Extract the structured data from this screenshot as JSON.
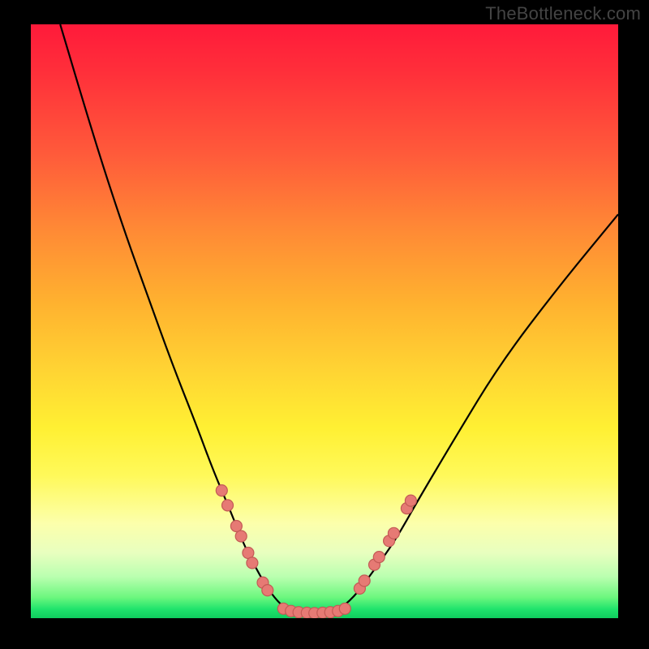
{
  "watermark": "TheBottleneck.com",
  "chart_data": {
    "type": "line",
    "title": "",
    "xlabel": "",
    "ylabel": "",
    "xlim": [
      0,
      100
    ],
    "ylim": [
      0,
      100
    ],
    "grid": false,
    "legend": false,
    "series": [
      {
        "name": "left-curve",
        "x": [
          5,
          8,
          12,
          16,
          20,
          24,
          28,
          31,
          34,
          36,
          38,
          40,
          42,
          44
        ],
        "y": [
          100,
          90,
          77,
          65,
          54,
          43,
          33,
          25,
          18,
          13,
          9,
          5.5,
          2.8,
          1.2
        ]
      },
      {
        "name": "flat-bottom",
        "x": [
          44,
          46,
          48,
          50,
          52
        ],
        "y": [
          1.2,
          0.9,
          0.8,
          0.9,
          1.1
        ]
      },
      {
        "name": "right-curve",
        "x": [
          52,
          55,
          58,
          62,
          66,
          72,
          80,
          90,
          100
        ],
        "y": [
          1.1,
          3.5,
          7.5,
          13,
          20,
          30,
          43,
          56,
          68
        ]
      }
    ],
    "markers": [
      {
        "x": 32.5,
        "y": 21.5
      },
      {
        "x": 33.5,
        "y": 19.0
      },
      {
        "x": 35.0,
        "y": 15.5
      },
      {
        "x": 35.8,
        "y": 13.8
      },
      {
        "x": 37.0,
        "y": 11.0
      },
      {
        "x": 37.7,
        "y": 9.3
      },
      {
        "x": 39.5,
        "y": 6.0
      },
      {
        "x": 40.3,
        "y": 4.7
      },
      {
        "x": 43.0,
        "y": 1.6
      },
      {
        "x": 44.3,
        "y": 1.2
      },
      {
        "x": 45.6,
        "y": 1.0
      },
      {
        "x": 47.0,
        "y": 0.9
      },
      {
        "x": 48.3,
        "y": 0.85
      },
      {
        "x": 49.7,
        "y": 0.9
      },
      {
        "x": 51.0,
        "y": 1.0
      },
      {
        "x": 52.3,
        "y": 1.2
      },
      {
        "x": 53.5,
        "y": 1.6
      },
      {
        "x": 56.0,
        "y": 5.0
      },
      {
        "x": 56.8,
        "y": 6.3
      },
      {
        "x": 58.5,
        "y": 9.0
      },
      {
        "x": 59.3,
        "y": 10.3
      },
      {
        "x": 61.0,
        "y": 13.0
      },
      {
        "x": 61.8,
        "y": 14.3
      },
      {
        "x": 64.0,
        "y": 18.5
      },
      {
        "x": 64.7,
        "y": 19.8
      }
    ],
    "colors": {
      "curve": "#000000",
      "marker_fill": "#e67a74",
      "marker_stroke": "#c35a55"
    }
  }
}
